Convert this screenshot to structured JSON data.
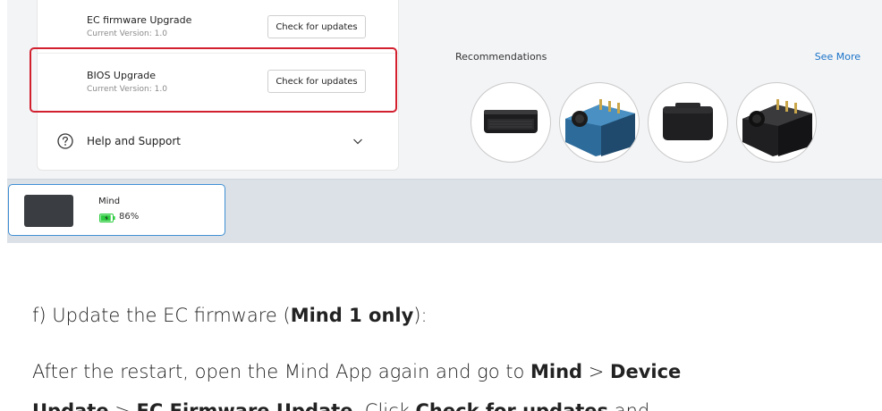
{
  "settings": {
    "ec_row": {
      "title": "EC firmware Upgrade",
      "version": "Current Version: 1.0",
      "button": "Check for updates"
    },
    "bios_row": {
      "title": "BIOS Upgrade",
      "version": "Current Version: 1.0",
      "button": "Check for updates"
    },
    "help_row": {
      "icon": "question-circle-icon",
      "label": "Help and Support",
      "chevron": "chevron-down-icon"
    },
    "highlight_color": "#d2202f"
  },
  "recommendations": {
    "title": "Recommendations",
    "see_more": "See More",
    "link_color": "#1a73c9",
    "products": [
      "mini-pc-black",
      "mini-pc-blue",
      "mini-pc-black-square",
      "mini-pc-dark"
    ]
  },
  "device": {
    "name": "Mind",
    "battery_percent": "86%",
    "battery_level": 0.86,
    "battery_color": "#2ecc40",
    "selected_border_color": "#3f8fd4"
  },
  "doc": {
    "line1": {
      "prefix": "f) Update the EC firmware (",
      "bold": "Mind 1 only",
      "suffix": "):"
    },
    "line2": {
      "prefix": "After the restart, open the Mind App again and go to ",
      "bold1": "Mind",
      "sep": " > ",
      "bold2": "Device"
    },
    "line3": {
      "bold1": "Update",
      "sep": " > ",
      "bold2": "EC Firmware Update",
      "mid": ". Click ",
      "bold3": "Check for updates",
      "suffix": " and"
    }
  }
}
